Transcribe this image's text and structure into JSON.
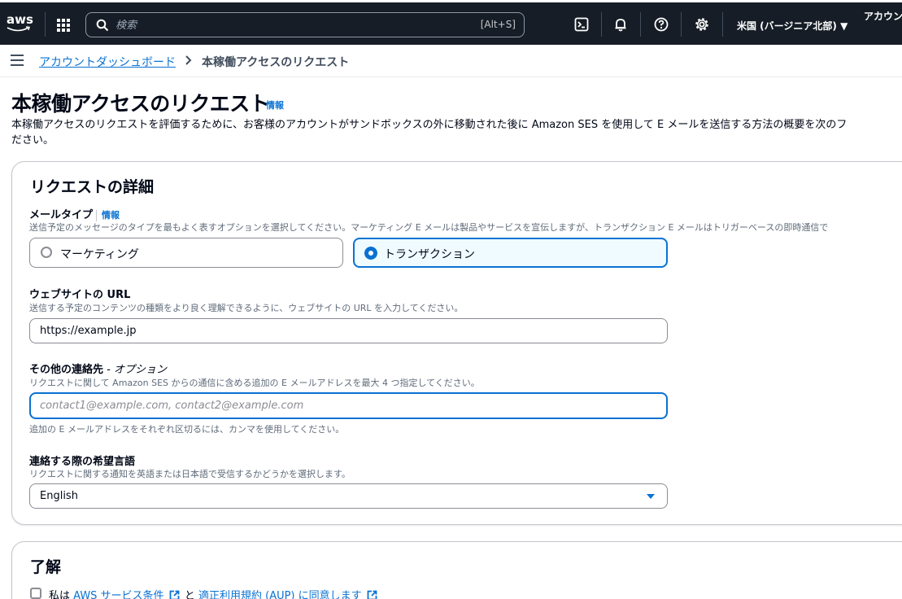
{
  "topnav": {
    "logo": "aws",
    "search_placeholder": "検索",
    "search_shortcut": "[Alt+S]",
    "region": "米国 (バージニア北部) ▼",
    "account": "アカウン",
    "icons": [
      "apps-grid-icon",
      "search-icon",
      "cloudshell-icon",
      "bell-icon",
      "help-icon",
      "gear-icon"
    ]
  },
  "breadcrumb": {
    "parent": "アカウントダッシュボード",
    "current": "本稼働アクセスのリクエスト"
  },
  "header": {
    "title": "本稼働アクセスのリクエスト",
    "info": "情報",
    "description_line1": "本稼働アクセスのリクエストを評価するために、お客様のアカウントがサンドボックスの外に移動された後に Amazon SES を使用して E メールを送信する方法の概要を次のフ",
    "description_line2": "ださい。"
  },
  "details": {
    "heading": "リクエストの詳細",
    "mail_type": {
      "label": "メールタイプ",
      "info": "情報",
      "description": "送信予定のメッセージのタイプを最もよく表すオプションを選択してください。マーケティング E メールは製品やサービスを宣伝しますが、トランザクション E メールはトリガーベースの即時通信で",
      "options": [
        "マーケティング",
        "トランザクション"
      ],
      "selected": "トランザクション"
    },
    "website": {
      "label": "ウェブサイトの URL",
      "description": "送信する予定のコンテンツの種類をより良く理解できるように、ウェブサイトの URL を入力してください。",
      "value": "https://example.jp"
    },
    "contacts": {
      "label": "その他の連絡先",
      "optional": " - オプション",
      "description": "リクエストに関して Amazon SES からの通信に含める追加の E メールアドレスを最大 4 つ指定してください。",
      "placeholder": "contact1@example.com, contact2@example.com",
      "hint": "追加の E メールアドレスをそれぞれ区切るには、カンマを使用してください。"
    },
    "language": {
      "label": "連絡する際の希望言語",
      "description": "リクエストに関する通知を英語または日本語で受信するかどうかを選択します。",
      "value": "English"
    }
  },
  "acknowledge": {
    "heading": "了解",
    "prefix": "私は ",
    "link1": "AWS サービス条件",
    "middle": " と ",
    "link2": "適正利用規約 (AUP) に同意します",
    "checked": false
  },
  "colors": {
    "nav_bg": "#161d26",
    "link": "#0972d3",
    "border": "#8c8c94",
    "selected_bg": "#f0fbff"
  }
}
